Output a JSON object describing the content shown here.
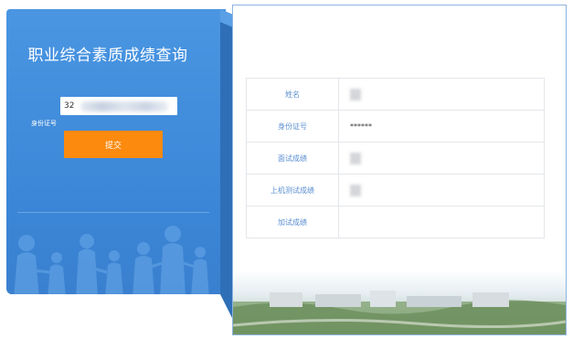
{
  "left": {
    "title": "职业综合素质成绩查询",
    "id_label": "身份证号",
    "id_value": "32",
    "submit_label": "提交"
  },
  "results": {
    "rows": [
      {
        "label": "姓名",
        "value": ""
      },
      {
        "label": "身份证号",
        "value": "******"
      },
      {
        "label": "面试成绩",
        "value": ""
      },
      {
        "label": "上机测试成绩",
        "value": ""
      },
      {
        "label": "加试成绩",
        "value": ""
      }
    ]
  },
  "colors": {
    "panel_blue": "#3b86d6",
    "button_orange": "#fb8a0e",
    "label_blue": "#5b8fd0"
  },
  "icons": [
    "people-silhouette-icon",
    "campus-photo"
  ]
}
